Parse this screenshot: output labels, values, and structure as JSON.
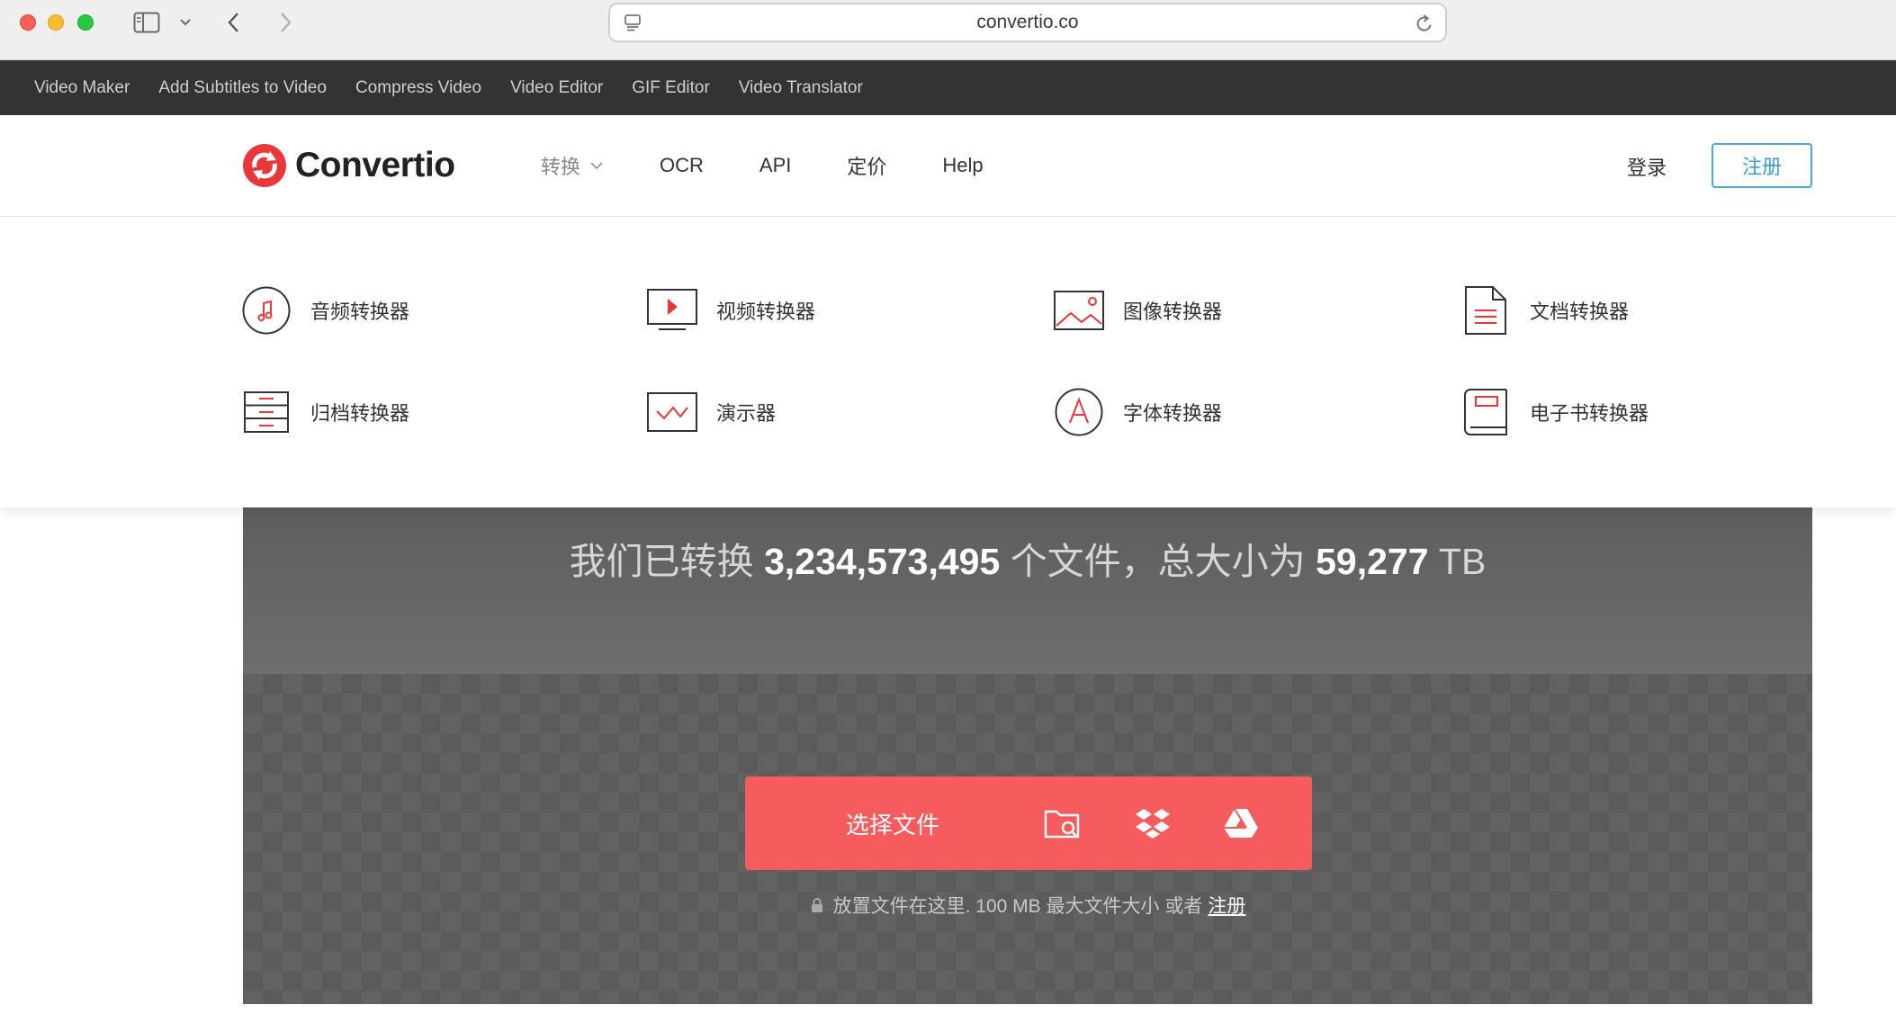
{
  "browser": {
    "url": "convertio.co"
  },
  "topbar": {
    "links": [
      "Video Maker",
      "Add Subtitles to Video",
      "Compress Video",
      "Video Editor",
      "GIF Editor",
      "Video Translator"
    ]
  },
  "header": {
    "brand": "Convertio",
    "brand_color": "#e9373c",
    "nav": {
      "convert": "转换",
      "ocr": "OCR",
      "api": "API",
      "pricing": "定价",
      "help": "Help"
    },
    "login": "登录",
    "signup": "注册"
  },
  "dropdown": {
    "items": [
      {
        "label": "音频转换器",
        "icon": "music-note-icon"
      },
      {
        "label": "视频转换器",
        "icon": "video-play-icon"
      },
      {
        "label": "图像转换器",
        "icon": "image-icon"
      },
      {
        "label": "文档转换器",
        "icon": "document-icon"
      },
      {
        "label": "归档转换器",
        "icon": "archive-icon"
      },
      {
        "label": "演示器",
        "icon": "presentation-icon"
      },
      {
        "label": "字体转换器",
        "icon": "font-icon"
      },
      {
        "label": "电子书转换器",
        "icon": "ebook-icon"
      }
    ]
  },
  "stats": {
    "prefix": "我们已转换",
    "files_count": "3,234,573,495",
    "middle": "个文件，总大小为",
    "total_size": "59,277",
    "unit": "TB"
  },
  "upload": {
    "choose_files": "选择文件",
    "hint_text": "放置文件在这里. 100 MB 最大文件大小 或者",
    "hint_link": "注册",
    "accent_color": "#f65b5d"
  }
}
